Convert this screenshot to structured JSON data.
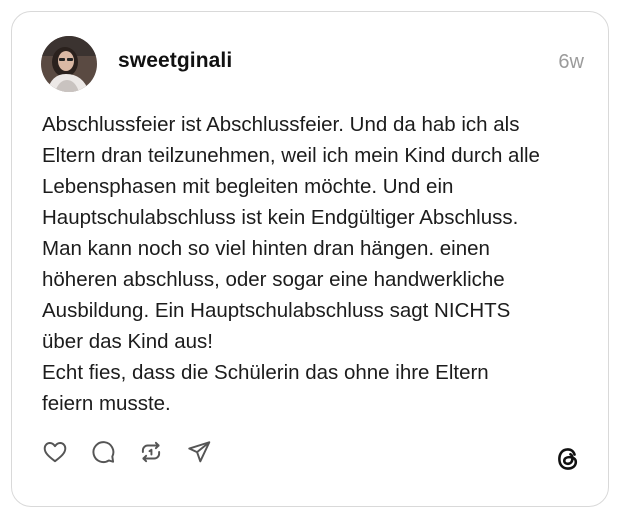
{
  "post": {
    "username": "sweetginali",
    "timestamp": "6w",
    "lines": [
      "Abschlussfeier ist Abschlussfeier. Und da hab ich als",
      "Eltern dran teilzunehmen, weil ich mein Kind durch alle",
      "Lebensphasen mit begleiten möchte. Und ein",
      "Hauptschulabschluss ist kein Endgültiger Abschluss.",
      "Man kann noch so viel hinten dran hängen. einen",
      "höheren abschluss, oder sogar eine handwerkliche",
      "Ausbildung. Ein Hauptschulabschluss sagt NICHTS",
      "über das Kind aus!",
      "Echt fies, dass die Schülerin das ohne ihre Eltern",
      "feiern musste."
    ]
  },
  "actions": {
    "like_icon": "heart-icon",
    "comment_icon": "comment-icon",
    "repost_icon": "repost-icon",
    "share_icon": "send-icon"
  },
  "brand": {
    "logo_icon": "threads-logo-icon"
  },
  "colors": {
    "border": "#d9d9d9",
    "text": "#1c1c1c",
    "muted": "#9b9b9b",
    "icon": "#555555"
  }
}
